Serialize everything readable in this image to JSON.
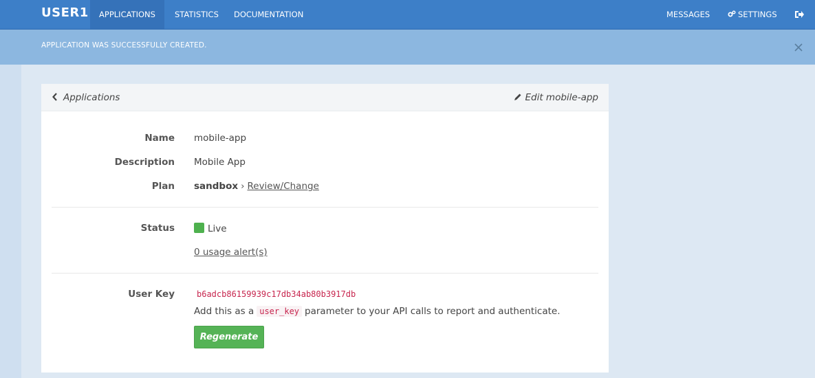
{
  "nav": {
    "brand": "USER1",
    "items": [
      {
        "label": "Applications",
        "active": true
      },
      {
        "label": "Statistics",
        "active": false
      },
      {
        "label": "Documentation",
        "active": false
      }
    ],
    "right_items": [
      {
        "label": "Messages"
      },
      {
        "label": "Settings",
        "icon": "gears-icon"
      }
    ],
    "logout_icon": "logout-icon"
  },
  "alert": {
    "message": "Application was successfully created.",
    "close_icon": "close-icon"
  },
  "card": {
    "back_label": "Applications",
    "edit_label": "Edit mobile-app",
    "fields": {
      "name_label": "Name",
      "name_value": "mobile-app",
      "description_label": "Description",
      "description_value": "Mobile App",
      "plan_label": "Plan",
      "plan_value": "sandbox",
      "plan_separator": "›",
      "plan_link": "Review/Change",
      "status_label": "Status",
      "status_value": "Live",
      "usage_alerts_link": "0 usage alert(s)",
      "user_key_label": "User Key",
      "user_key_value": "b6adcb86159939c17db34ab80b3917db",
      "help_prefix": "Add this as a",
      "help_code": "user_key",
      "help_suffix": "parameter to your API calls to report and authenticate.",
      "regenerate_label": "Regenerate"
    }
  },
  "colors": {
    "topbar": "#3d7fc8",
    "alert": "#8cb7e0",
    "live": "#4eb14e",
    "button": "#55b356",
    "key": "#c7254e"
  }
}
